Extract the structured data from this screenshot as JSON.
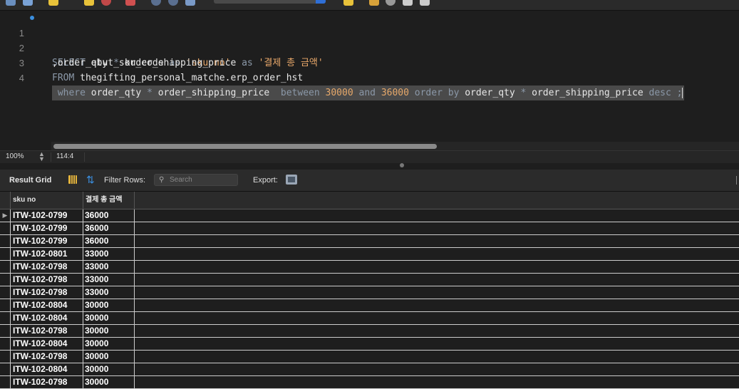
{
  "editor": {
    "lines": [
      {
        "num": "1",
        "parts": [
          {
            "t": "SELECT",
            "c": "kw"
          },
          {
            "t": " ebut_sku_code ",
            "c": ""
          },
          {
            "t": "as",
            "c": "kw"
          },
          {
            "t": " ",
            "c": ""
          },
          {
            "t": "'sku no'",
            "c": "str"
          }
        ]
      },
      {
        "num": "2",
        "parts": [
          {
            "t": ",order_qty ",
            "c": ""
          },
          {
            "t": "*",
            "c": "op"
          },
          {
            "t": " order_shipping_price ",
            "c": ""
          },
          {
            "t": "as",
            "c": "kw"
          },
          {
            "t": " ",
            "c": ""
          },
          {
            "t": "'결제 총 금액'",
            "c": "str"
          }
        ]
      },
      {
        "num": "3",
        "parts": [
          {
            "t": "FROM",
            "c": "kw"
          },
          {
            "t": " thegifting_personal_matche.erp_order_hst",
            "c": ""
          }
        ]
      },
      {
        "num": "4",
        "parts": [
          {
            "t": " where",
            "c": "kw"
          },
          {
            "t": " order_qty ",
            "c": ""
          },
          {
            "t": "*",
            "c": "op"
          },
          {
            "t": " order_shipping_price  ",
            "c": ""
          },
          {
            "t": "between",
            "c": "kw"
          },
          {
            "t": " ",
            "c": ""
          },
          {
            "t": "30000",
            "c": "num"
          },
          {
            "t": " ",
            "c": ""
          },
          {
            "t": "and",
            "c": "kw"
          },
          {
            "t": " ",
            "c": ""
          },
          {
            "t": "36000",
            "c": "num"
          },
          {
            "t": " ",
            "c": ""
          },
          {
            "t": "order by",
            "c": "kw"
          },
          {
            "t": " order_qty ",
            "c": ""
          },
          {
            "t": "*",
            "c": "op"
          },
          {
            "t": " order_shipping_price ",
            "c": ""
          },
          {
            "t": "desc",
            "c": "kw"
          },
          {
            "t": " ;",
            "c": "op"
          }
        ]
      }
    ]
  },
  "status": {
    "zoom": "100%",
    "cursor_pos": "114:4"
  },
  "grid_toolbar": {
    "title": "Result Grid",
    "filter_label": "Filter Rows:",
    "search_placeholder": "Search",
    "export_label": "Export:"
  },
  "grid": {
    "columns": [
      "sku no",
      "결제 총 금액"
    ],
    "rows": [
      [
        "ITW-102-0799",
        "36000"
      ],
      [
        "ITW-102-0799",
        "36000"
      ],
      [
        "ITW-102-0799",
        "36000"
      ],
      [
        "ITW-102-0801",
        "33000"
      ],
      [
        "ITW-102-0798",
        "33000"
      ],
      [
        "ITW-102-0798",
        "33000"
      ],
      [
        "ITW-102-0798",
        "33000"
      ],
      [
        "ITW-102-0804",
        "30000"
      ],
      [
        "ITW-102-0804",
        "30000"
      ],
      [
        "ITW-102-0798",
        "30000"
      ],
      [
        "ITW-102-0804",
        "30000"
      ],
      [
        "ITW-102-0798",
        "30000"
      ],
      [
        "ITW-102-0804",
        "30000"
      ],
      [
        "ITW-102-0798",
        "30000"
      ]
    ]
  },
  "colors": {
    "accent": "#3b8fe0",
    "keyword": "#8b98a8",
    "string": "#e9a86a"
  }
}
